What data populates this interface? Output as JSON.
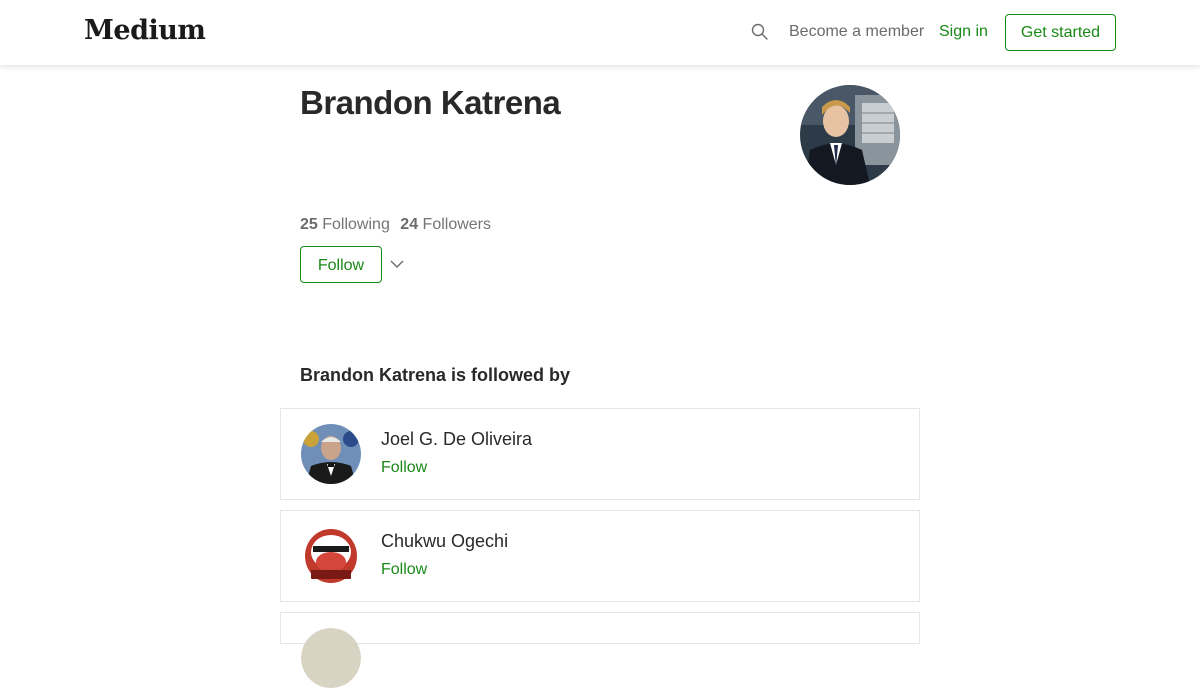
{
  "header": {
    "logo": "Medium",
    "become_member": "Become a member",
    "sign_in": "Sign in",
    "get_started": "Get started",
    "search_icon": "search-icon"
  },
  "profile": {
    "name": "Brandon Katrena",
    "following_count": "25",
    "following_label": "Following",
    "followers_count": "24",
    "followers_label": "Followers",
    "follow_button": "Follow"
  },
  "followed_by": {
    "title": "Brandon Katrena is followed by",
    "items": [
      {
        "name": "Joel G. De Oliveira",
        "action": "Follow"
      },
      {
        "name": "Chukwu Ogechi",
        "action": "Follow"
      }
    ]
  },
  "colors": {
    "accent": "#1a8917",
    "text": "#292929",
    "muted": "#757575",
    "border": "#e6e6e6"
  }
}
